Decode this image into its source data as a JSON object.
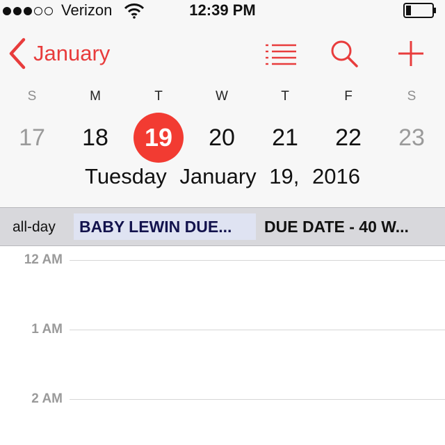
{
  "status_bar": {
    "signal_dots": [
      true,
      true,
      true,
      false,
      false
    ],
    "carrier": "Verizon",
    "wifi_icon": "wifi-icon",
    "time": "12:39 PM",
    "battery_icon": "battery-icon",
    "battery_level": 0.2
  },
  "nav": {
    "back_label": "January",
    "back_icon": "chevron-left-icon",
    "actions": [
      "list-icon",
      "search-icon",
      "add-icon"
    ],
    "accent_color": "#e83c3c"
  },
  "week": {
    "weekdays": [
      "S",
      "M",
      "T",
      "W",
      "T",
      "F",
      "S"
    ],
    "days": [
      "17",
      "18",
      "19",
      "20",
      "21",
      "22",
      "23"
    ],
    "selected_index": 2,
    "selected_color": "#f23b32",
    "full_date": "Tuesday  January 19, 2016"
  },
  "all_day": {
    "label": "all-day",
    "events": [
      {
        "title": "BABY LEWIN DUE..."
      },
      {
        "title": "DUE DATE - 40 W..."
      }
    ]
  },
  "timeline": {
    "hours": [
      "12 AM",
      "1 AM",
      "2 AM"
    ]
  }
}
